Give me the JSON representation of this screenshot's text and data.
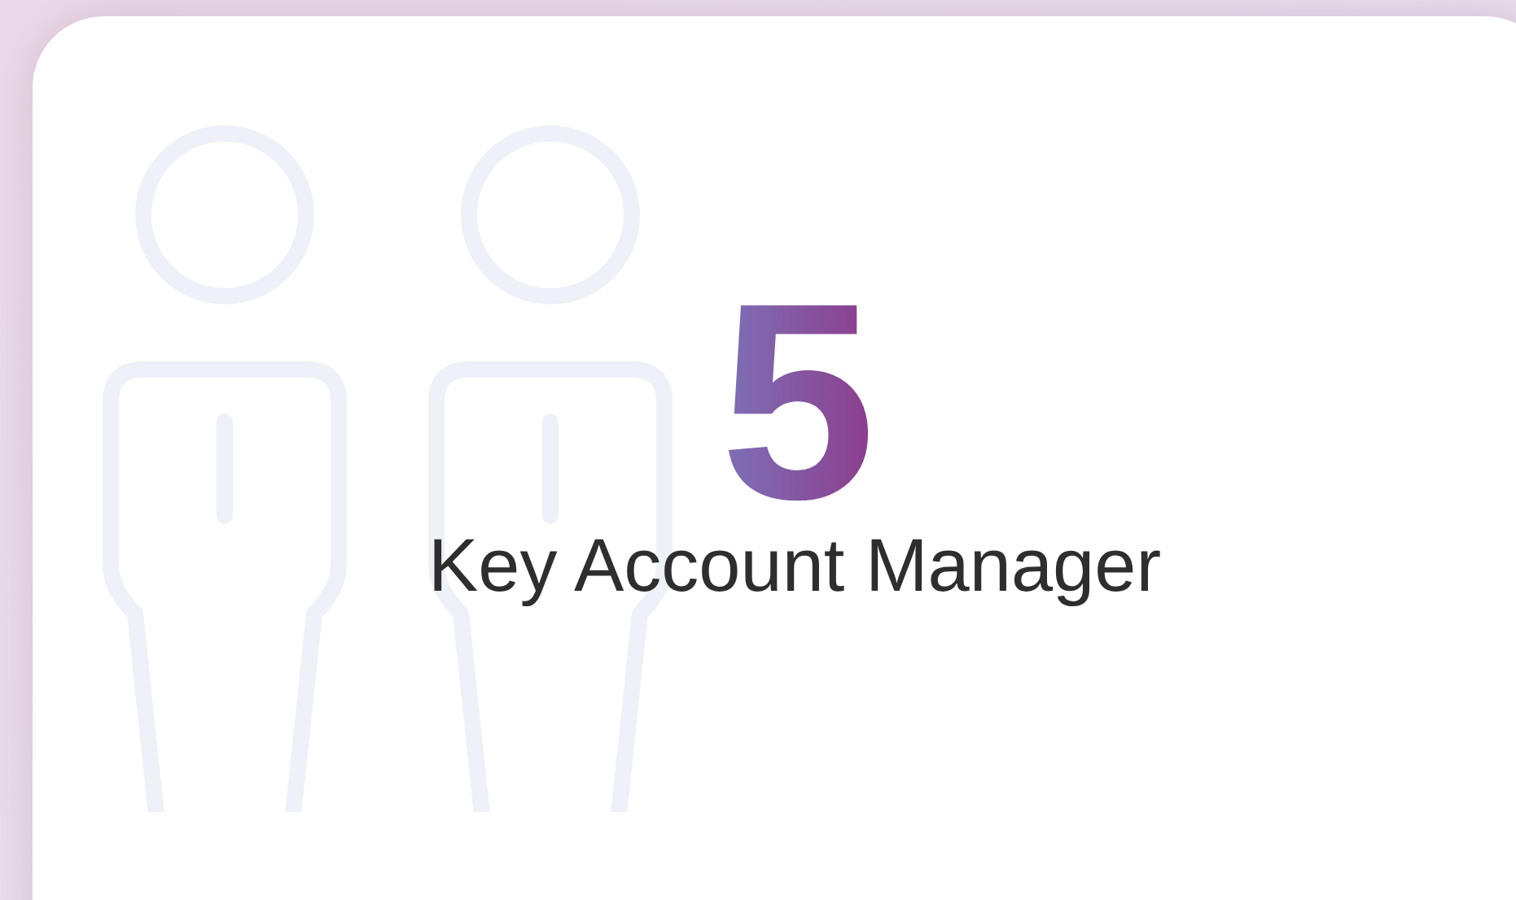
{
  "card": {
    "count": "5",
    "label": "Key Account Manager"
  }
}
